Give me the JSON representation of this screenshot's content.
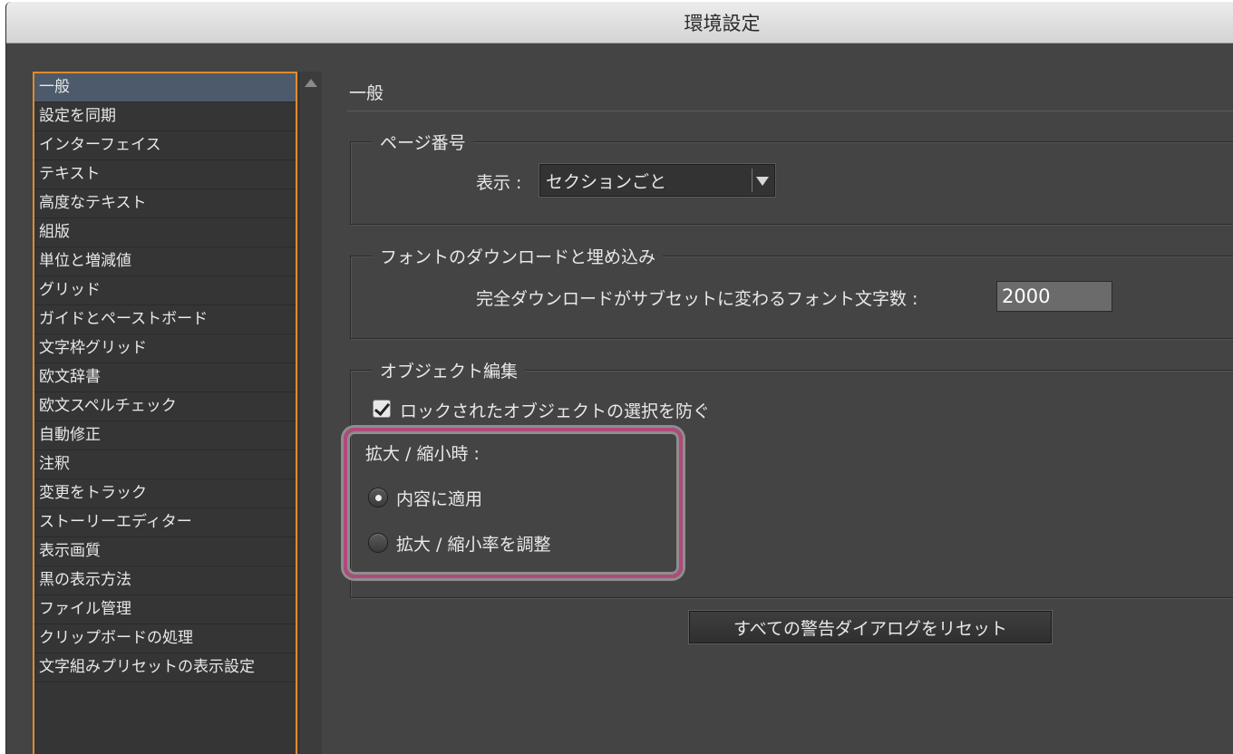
{
  "window": {
    "title": "環境設定"
  },
  "sidebar": {
    "items": [
      {
        "label": "一般",
        "selected": true
      },
      {
        "label": "設定を同期"
      },
      {
        "label": "インターフェイス"
      },
      {
        "label": "テキスト"
      },
      {
        "label": "高度なテキスト"
      },
      {
        "label": "組版"
      },
      {
        "label": "単位と増減値"
      },
      {
        "label": "グリッド"
      },
      {
        "label": "ガイドとペーストボード"
      },
      {
        "label": "文字枠グリッド"
      },
      {
        "label": "欧文辞書"
      },
      {
        "label": "欧文スペルチェック"
      },
      {
        "label": "自動修正"
      },
      {
        "label": "注釈"
      },
      {
        "label": "変更をトラック"
      },
      {
        "label": "ストーリーエディター"
      },
      {
        "label": "表示画質"
      },
      {
        "label": "黒の表示方法"
      },
      {
        "label": "ファイル管理"
      },
      {
        "label": "クリップボードの処理"
      },
      {
        "label": "文字組みプリセットの表示設定"
      }
    ]
  },
  "main": {
    "section_title": "一般",
    "page_numbers": {
      "title": "ページ番号",
      "display_label": "表示 :",
      "display_value": "セクションごと"
    },
    "font_download": {
      "title": "フォントのダウンロードと埋め込み",
      "threshold_label": "完全ダウンロードがサブセットに変わるフォント文字数 :",
      "threshold_value": "2000"
    },
    "object_editing": {
      "title": "オブジェクト編集",
      "prevent_locked_label": "ロックされたオブジェクトの選択を防ぐ",
      "prevent_locked_checked": true,
      "scaling_label": "拡大 / 縮小時 :",
      "apply_to_content_label": "内容に適用",
      "adjust_scaling_label": "拡大 / 縮小率を調整",
      "selected_option": "apply_to_content"
    },
    "reset_button_label": "すべての警告ダイアログをリセット"
  },
  "colors": {
    "background": "#444444",
    "sidebar_border": "#e08a2c",
    "selection": "#4c5a6b",
    "highlight": "#b04a7a"
  }
}
